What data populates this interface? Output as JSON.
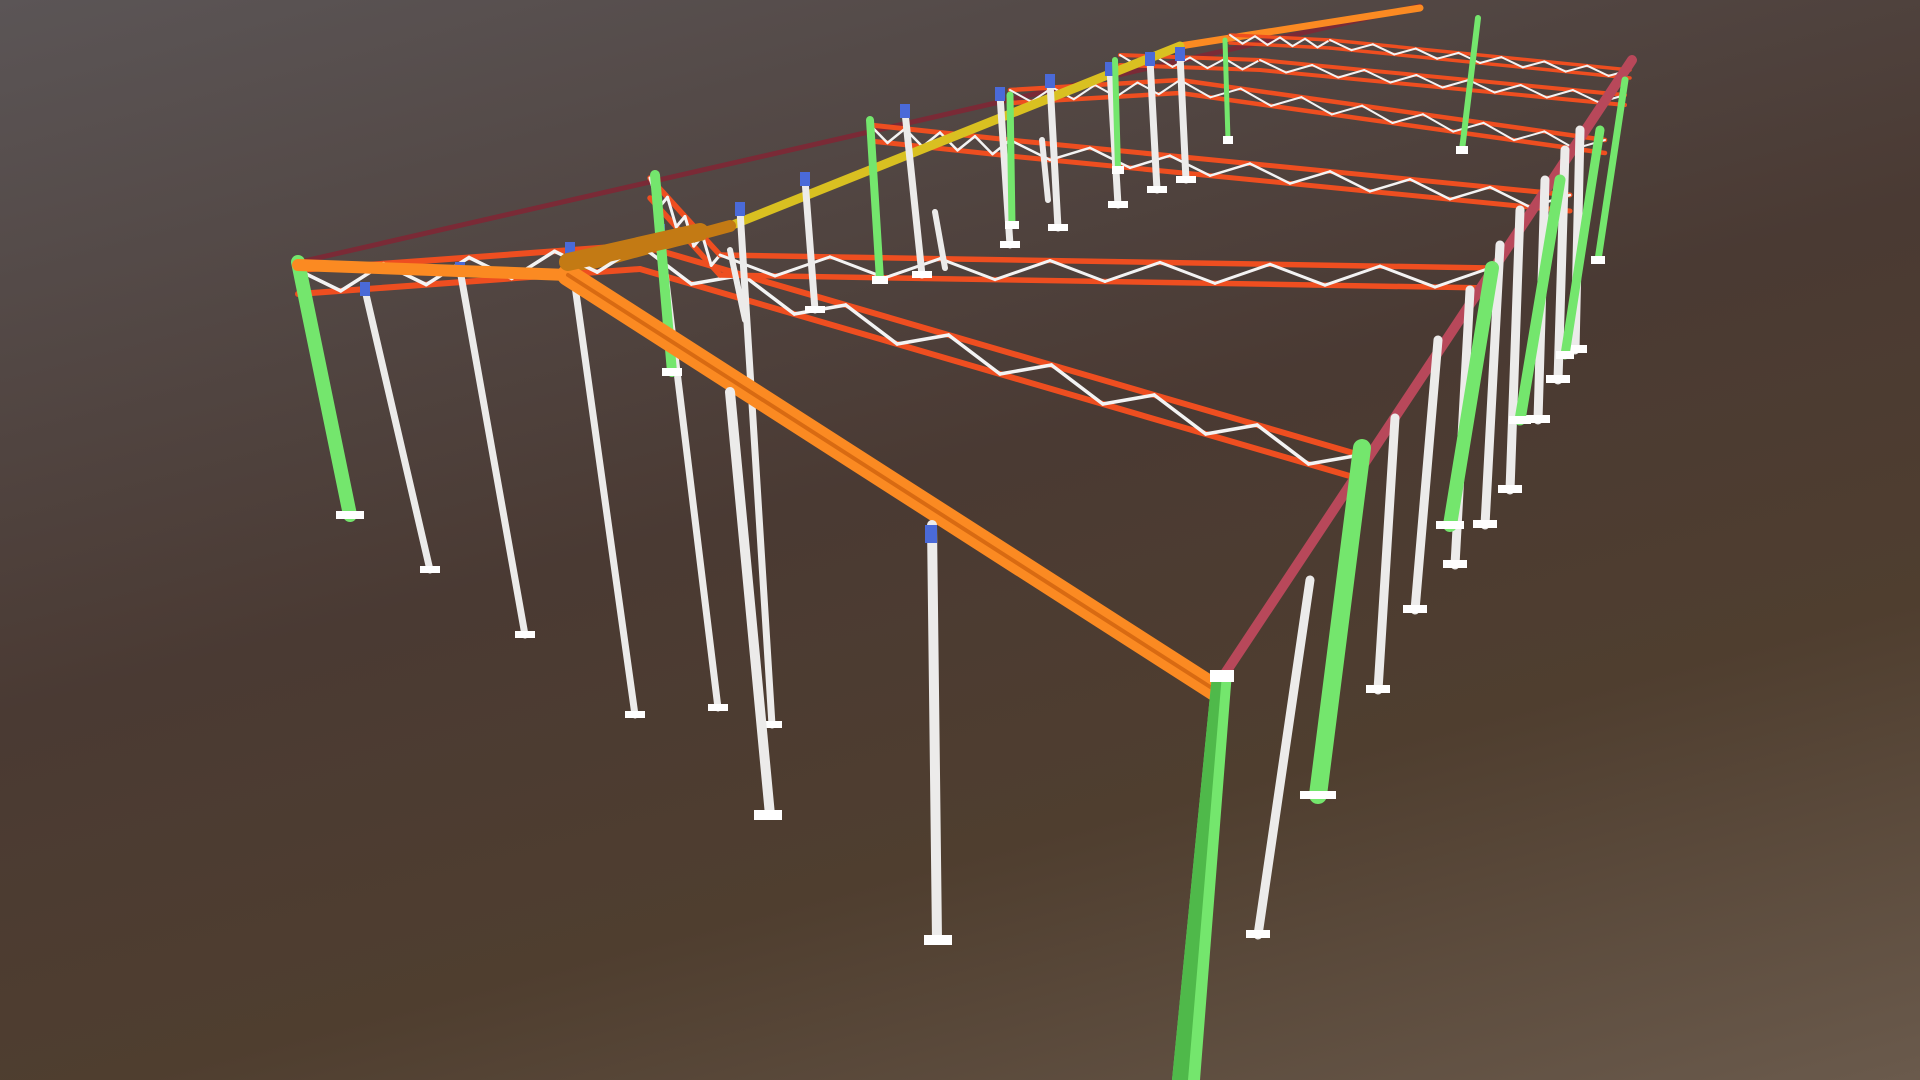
{
  "scene": {
    "subject": "steel-frame-structure",
    "colors": {
      "column_main": "#74e66d",
      "column_main_shade": "#4fb94a",
      "column_secondary": "#ecebea",
      "column_secondary_shade": "#b9b7b4",
      "truss_chord": "#ee4e20",
      "truss_web": "#f3f3f3",
      "gable_rafter": "#fb8a22",
      "gable_rafter_shade": "#d86a12",
      "ridge_beam": "#d9c021",
      "ridge_beam_dark": "#c37a14",
      "eave_beam": "#b8485a",
      "eave_beam_far": "#7a2a36",
      "connector": "#4a6ad8",
      "base_plate": "#ffffff"
    }
  }
}
